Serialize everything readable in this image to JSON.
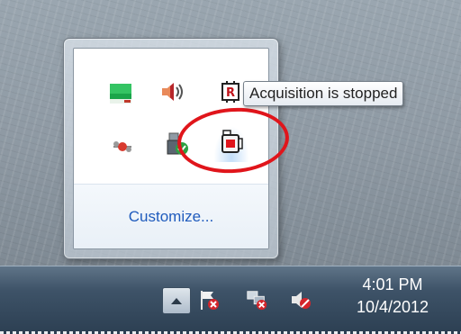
{
  "flyout": {
    "icons": [
      "battery-monitor-icon",
      "volume-icon",
      "r-app-icon",
      "network-disconnected-icon",
      "usb-safely-remove-icon",
      "acquisition-icon"
    ],
    "customize_label": "Customize..."
  },
  "tooltip": {
    "text": "Acquisition is stopped"
  },
  "taskbar": {
    "clock_time": "4:01 PM",
    "clock_date": "10/4/2012",
    "icons": [
      "show-hidden-icons-button",
      "action-center-flag-icon",
      "network-icon",
      "volume-muted-icon"
    ]
  },
  "colors": {
    "highlight_circle": "#e0151b",
    "link": "#1f5bbd"
  }
}
